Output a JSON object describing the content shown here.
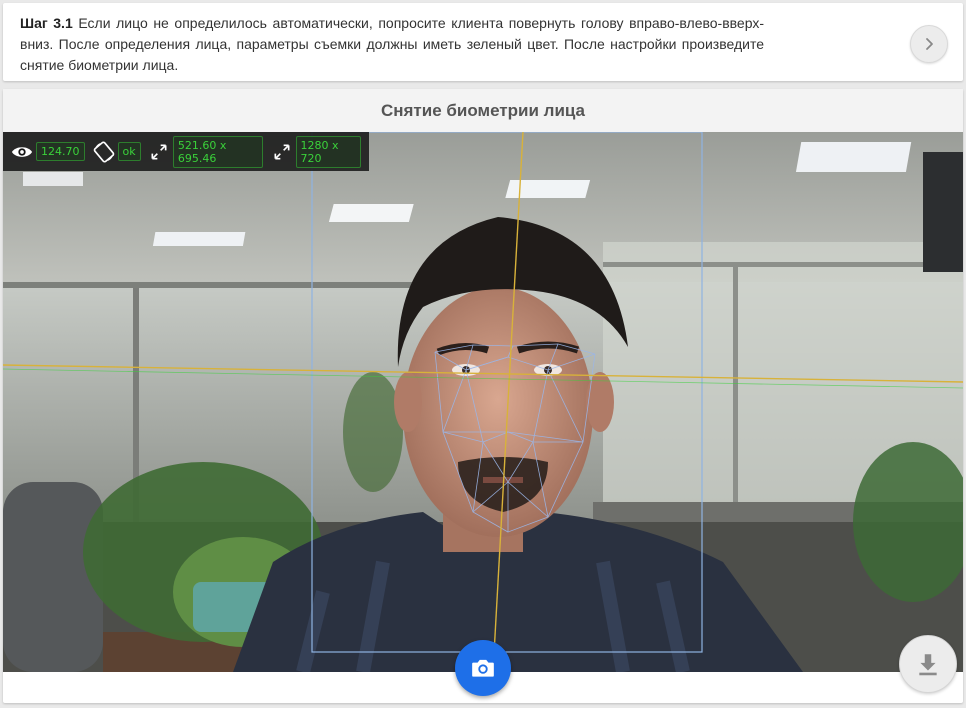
{
  "instruction": {
    "step_label": "Шаг 3.1",
    "text": " Если лицо не определилось автоматически, попросите клиента повернуть голову вправо-влево-вверх-вниз. После определения лица, параметры съемки должны иметь зеленый цвет. После настройки произведите снятие биометрии лица.",
    "next_icon": "chevron-right-icon"
  },
  "capture": {
    "title": "Снятие биометрии лица",
    "stats": {
      "visibility_value": "124.70",
      "rotation_value": "ok",
      "face_size": "521.60 x 695.46",
      "frame_size": "1280 x 720",
      "status_color": "#3ad13a"
    },
    "camera_icon": "camera-icon",
    "download_icon": "download-icon",
    "accent_color": "#1e6fe8"
  }
}
